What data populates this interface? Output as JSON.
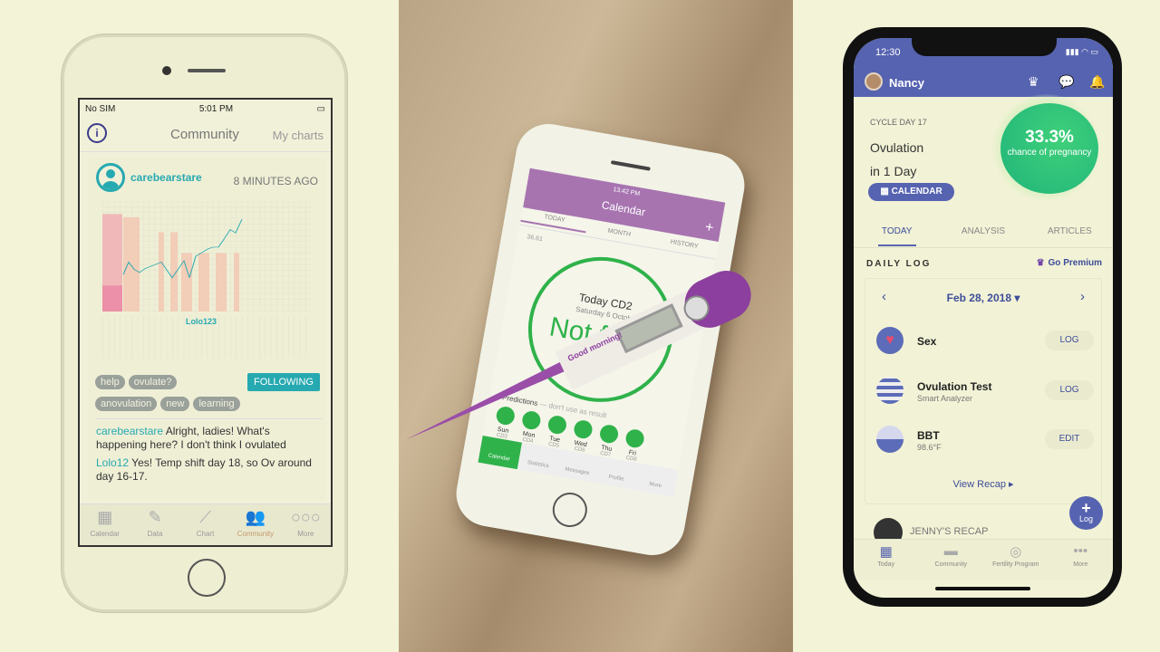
{
  "left_app": {
    "status": {
      "carrier": "No SIM",
      "time": "5:01 PM"
    },
    "header": {
      "title": "Community",
      "my_charts": "My charts"
    },
    "post": {
      "username": "carebearstare",
      "time_ago": "8 MINUTES AGO",
      "chart_caption": "Lolo123",
      "tags": [
        "help",
        "ovulate?",
        "anovulation",
        "new",
        "learning"
      ],
      "follow_label": "FOLLOWING"
    },
    "comments": [
      {
        "user": "carebearstare",
        "text": "Alright, ladies! What's happening here? I don't think I ovulated"
      },
      {
        "user": "Lolo12",
        "text": "Yes! Temp shift day 18, so Ov around day 16-17."
      }
    ],
    "tabs": [
      {
        "label": "Calendar",
        "icon": "calendar-icon"
      },
      {
        "label": "Data",
        "icon": "pencil-icon"
      },
      {
        "label": "Chart",
        "icon": "chart-icon"
      },
      {
        "label": "Community",
        "icon": "people-icon",
        "active": true
      },
      {
        "label": "More",
        "icon": "more-icon"
      }
    ],
    "accent": "#26a9b0"
  },
  "middle_app": {
    "time": "13:42 PM",
    "title": "Calendar",
    "tabs": [
      "TODAY",
      "MONTH",
      "HISTORY"
    ],
    "temperature": "36.61",
    "today": "Today CD2",
    "date": "Saturday 6 Octob",
    "status": "Not f",
    "predictions_label": "Predictions",
    "predictions_note": "— don't use as result",
    "days": [
      {
        "day": "Sun",
        "cd": "CD3"
      },
      {
        "day": "Mon",
        "cd": "CD4"
      },
      {
        "day": "Tue",
        "cd": "CD5"
      },
      {
        "day": "Wed",
        "cd": "CD6"
      },
      {
        "day": "Thu",
        "cd": "CD7"
      },
      {
        "day": "Fri",
        "cd": "CD8"
      }
    ],
    "tabbar": [
      "Calendar",
      "Statistics",
      "Messages",
      "Profile",
      "More"
    ],
    "thermometer_label": "Good morning!",
    "accent": "#2fb24a"
  },
  "right_app": {
    "time": "12:30",
    "user": "Nancy",
    "cycle_day": "CYCLE DAY 17",
    "ovulation_line1": "Ovulation",
    "ovulation_line2": "in 1 Day",
    "calendar_button": "CALENDAR",
    "chance_pct": "33.3%",
    "chance_label": "chance of pregnancy",
    "tabs": [
      "TODAY",
      "ANALYSIS",
      "ARTICLES"
    ],
    "daily_log": "DAILY LOG",
    "go_premium": "Go Premium",
    "date": "Feb 28, 2018",
    "items": [
      {
        "title": "Sex",
        "subtitle": "",
        "button": "LOG"
      },
      {
        "title": "Ovulation Test",
        "subtitle": "Smart Analyzer",
        "button": "LOG"
      },
      {
        "title": "BBT",
        "subtitle": "98.6°F",
        "button": "EDIT"
      }
    ],
    "view_recap": "View Recap ▸",
    "fab_label": "Log",
    "jenny": "JENNY'S RECAP",
    "tabbar": [
      "Today",
      "Community",
      "Fertility Program",
      "More"
    ],
    "accent": "#5663b0"
  }
}
